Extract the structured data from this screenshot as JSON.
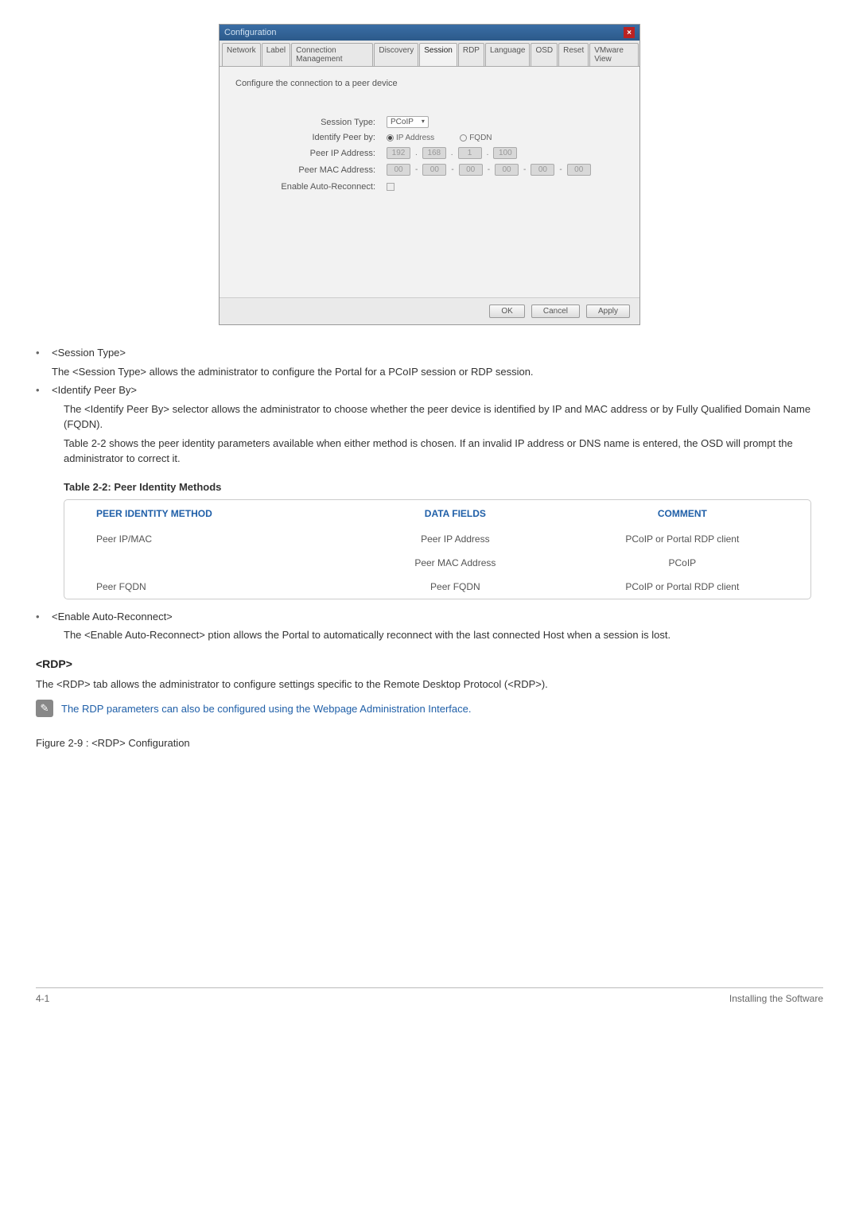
{
  "dialog": {
    "title": "Configuration",
    "tabs": [
      "Network",
      "Label",
      "Connection Management",
      "Discovery",
      "Session",
      "RDP",
      "Language",
      "OSD",
      "Reset",
      "VMware View"
    ],
    "active_tab": "Session",
    "desc": "Configure the connection to a peer device",
    "labels": {
      "session_type": "Session Type:",
      "identify_peer": "Identify Peer by:",
      "peer_ip": "Peer IP Address:",
      "peer_mac": "Peer MAC Address:",
      "auto_reconnect": "Enable Auto-Reconnect:"
    },
    "values": {
      "session_type": "PCoIP",
      "radio_ip": "IP Address",
      "radio_fqdn": "FQDN",
      "ip": [
        "192",
        "168",
        "1",
        "100"
      ],
      "mac": [
        "00",
        "00",
        "00",
        "00",
        "00",
        "00"
      ]
    },
    "buttons": {
      "ok": "OK",
      "cancel": "Cancel",
      "apply": "Apply"
    }
  },
  "bullets": {
    "b1_title": "<Session Type>",
    "b1_desc_a": "The <",
    "b1_desc_b": "Session Type",
    "b1_desc_c": "> allows the administrator to configure the Portal for a PCoIP session or RDP session.",
    "b2_title": "<Identify Peer By>",
    "b2_desc1": "The <Identify Peer By> selector allows the administrator to choose whether the peer device is identified by IP and MAC address or by Fully Qualified Domain Name (FQDN).",
    "b2_desc2": "Table 2-2 shows the peer identity parameters available when either method is chosen. If an invalid IP address or DNS name is entered, the OSD will prompt the administrator to correct it.",
    "b3_title": "<Enable Auto-Reconnect>",
    "b3_desc": "The <Enable Auto-Reconnect> ption allows the Portal to automatically reconnect with the last connected Host when a session is lost."
  },
  "table": {
    "title": "Table 2-2: Peer Identity Methods",
    "headers": [
      "PEER IDENTITY METHOD",
      "DATA FIELDS",
      "COMMENT"
    ],
    "rows": [
      [
        "Peer IP/MAC",
        "Peer IP Address",
        "PCoIP or Portal RDP client"
      ],
      [
        "",
        "Peer MAC Address",
        "PCoIP"
      ],
      [
        "Peer FQDN",
        "Peer FQDN",
        "PCoIP or Portal RDP client"
      ]
    ]
  },
  "rdp": {
    "heading": "<RDP>",
    "desc": "The <RDP> tab allows the administrator to configure settings specific to the Remote Desktop Protocol (<RDP>).",
    "note": "The RDP parameters can also be configured using the Webpage Administration Interface.",
    "fig": "Figure 2-9 : <RDP> Configuration"
  },
  "footer": {
    "left": "4-1",
    "right": "Installing the Software"
  }
}
